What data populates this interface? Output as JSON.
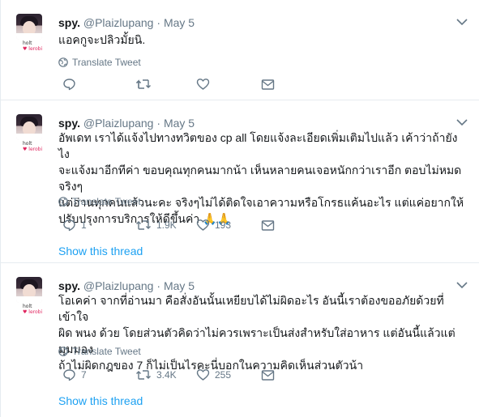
{
  "profile": {
    "avatar_caption_line1": "holt",
    "avatar_caption_line2": "♥ lerobi"
  },
  "tweets": [
    {
      "name": "spy.",
      "handle": "@Plaizlupang",
      "sep": "·",
      "date": "May 5",
      "text": "แอคกูจะปลิวมั้ยนิ.",
      "translate": "Translate Tweet",
      "reply_count": "",
      "retweet_count": "",
      "like_count": "",
      "show_thread": ""
    },
    {
      "name": "spy.",
      "handle": "@Plaizlupang",
      "sep": "·",
      "date": "May 5",
      "text": "อัพเดท เราได้แจ้งไปทางทวิตของ cp all โดยแจ้งละเอียดเพิ่มเติมไปแล้ว เค้าว่าถ้ายังไง\nจะแจ้งมาอีกทีค่า ขอบคุณทุกคนมากน้า เห็นหลายคนเจอหนักกว่าเราอีก ตอบไม่หมดจริงๆ\nแต่อ่านทุกคนแล้วนะคะ จริงๆไม่ได้ติดใจเอาความหรือโกรธแค้นอะไร แต่แค่อยากให้\nปรับปรุงการบริการให้ดีขึ้นค่า 🙏🙏",
      "translate": "Translate Tweet",
      "reply_count": "1",
      "retweet_count": "1.9K",
      "like_count": "193",
      "show_thread": "Show this thread"
    },
    {
      "name": "spy.",
      "handle": "@Plaizlupang",
      "sep": "·",
      "date": "May 5",
      "text": "โอเคค่า จากที่อ่านมา คือสั่งอันนั้นเหยียบได้ไม่ผิดอะไร อันนี้เราต้องขออภัยด้วยที่เข้าใจ\nผิด พนง ด้วย โดยส่วนตัวคิดว่าไม่ควรเพราะเป็นส่งสำหรับใส่อาหาร แต่อันนี้แล้วแต่มุมมอง\nถ้าไม่ผิดกฎของ 7 ก็ไม่เป็นไรคะนี่บอกในความคิดเห็นส่วนตัวน้า",
      "translate": "Translate Tweet",
      "reply_count": "7",
      "retweet_count": "3.4K",
      "like_count": "255",
      "show_thread": "Show this thread"
    }
  ],
  "colors": {
    "link": "#1da1f2",
    "secondary_text": "#657786",
    "border": "#e6ecf0"
  },
  "icons": {
    "reply": "reply-icon",
    "retweet": "retweet-icon",
    "like": "heart-icon",
    "dm": "envelope-icon",
    "globe": "globe-icon",
    "caret": "chevron-down-icon"
  }
}
